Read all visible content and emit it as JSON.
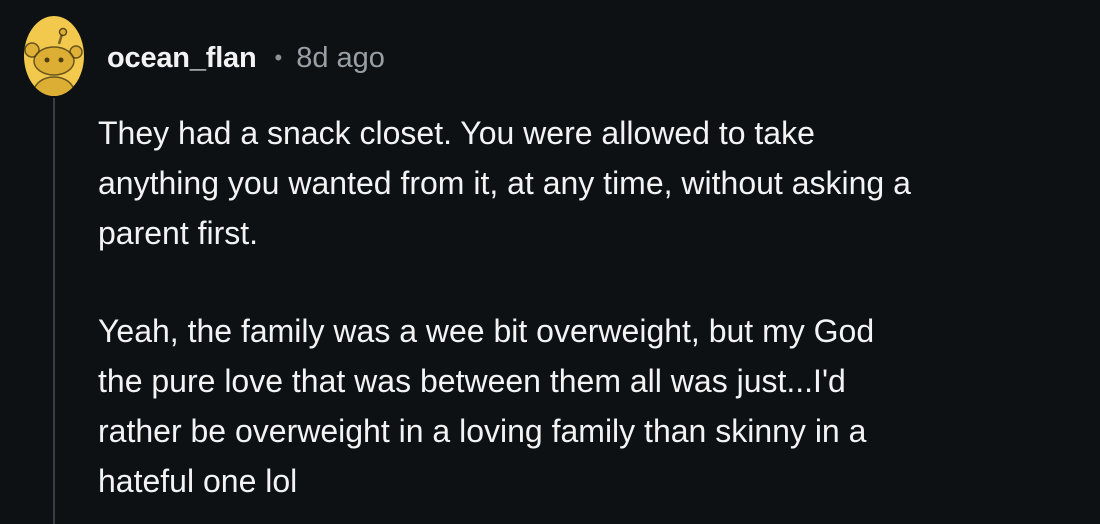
{
  "comment": {
    "author": "ocean_flan",
    "separator": "•",
    "time": "8d ago",
    "avatar_icon": "snoo-avatar-icon",
    "avatar_color": "#f2c94c",
    "paragraphs": [
      {
        "lines": [
          "They had a snack closet. You were allowed to take",
          "anything you wanted from it, at any time, without asking a",
          "parent first."
        ]
      },
      {
        "lines": [
          "Yeah, the family was a wee bit overweight, but my God",
          "the pure love that was between them all was just...I'd",
          "rather be overweight in a loving family than skinny in a",
          "hateful one lol"
        ]
      }
    ]
  }
}
